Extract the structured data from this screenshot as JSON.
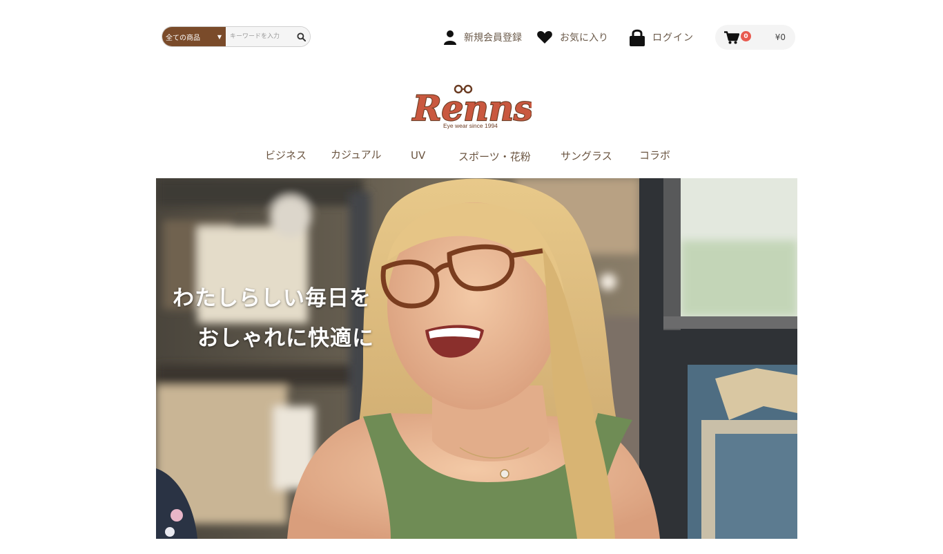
{
  "header": {
    "search": {
      "category_label": "全ての商品",
      "placeholder": "キーワードを入力"
    },
    "links": {
      "register": "新規会員登録",
      "favorites": "お気に入り",
      "login": "ログイン"
    },
    "cart": {
      "count": "0",
      "total": "¥0"
    }
  },
  "logo": {
    "name": "Renns",
    "tagline": "Eye wear since 1994"
  },
  "nav": {
    "items": [
      "ビジネス",
      "カジュアル",
      "UV",
      "スポーツ・花粉",
      "サングラス",
      "コラボ"
    ]
  },
  "hero": {
    "line1": "わたしらしい毎日を",
    "line2": "おしゃれに快適に"
  },
  "colors": {
    "brand_brown": "#7a4b2a",
    "badge_red": "#e85a4f",
    "logo_red": "#c9583f"
  }
}
